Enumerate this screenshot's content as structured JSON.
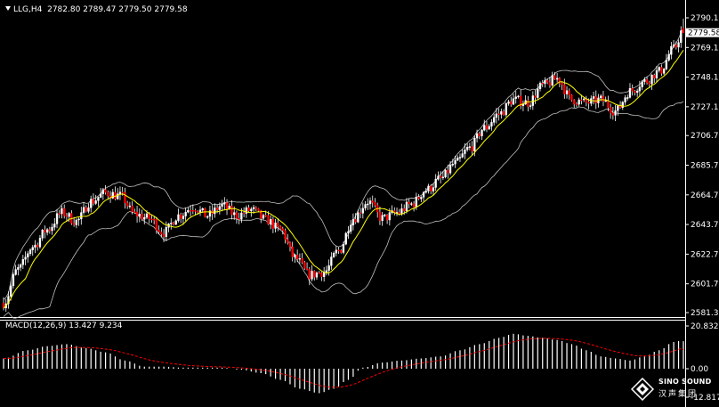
{
  "header": {
    "symbol": "LLG,H4",
    "open": "2782.80",
    "high": "2789.47",
    "low": "2779.50",
    "close": "2779.58"
  },
  "macd_header": {
    "name": "MACD(12,26,9)",
    "main": "13.427",
    "signal": "9.234"
  },
  "colors": {
    "background": "#000000",
    "bull_candle": "#ffffff",
    "bear_candle": "#ff0000",
    "wick": "#ffffff",
    "mid_band": "#ffff00",
    "bands": "#c0c0c0",
    "signal_line": "#ff0000",
    "axis": "#ffffff",
    "current_price_tag_bg": "#ffffff",
    "current_price_tag_text": "#000000"
  },
  "logo": {
    "icon": "diamond-logo-icon",
    "title": "SINO SOUND",
    "subtitle": "汉声集团"
  },
  "chart_data": [
    {
      "type": "candlestick",
      "title": "",
      "yaxis_ticks": [
        "2790.10",
        "2769.10",
        "2748.10",
        "2727.10",
        "2706.70",
        "2685.70",
        "2664.70",
        "2643.70",
        "2622.70",
        "2601.70",
        "2581.30"
      ],
      "ylim": [
        2581.3,
        2790.1
      ],
      "current_price": "2779.58",
      "grid": false,
      "keypoints": [
        [
          0,
          2588
        ],
        [
          6,
          2612
        ],
        [
          12,
          2628
        ],
        [
          18,
          2640
        ],
        [
          24,
          2652
        ],
        [
          30,
          2646
        ],
        [
          36,
          2660
        ],
        [
          42,
          2666
        ],
        [
          48,
          2664
        ],
        [
          54,
          2651
        ],
        [
          60,
          2648
        ],
        [
          66,
          2638
        ],
        [
          72,
          2650
        ],
        [
          78,
          2656
        ],
        [
          84,
          2650
        ],
        [
          90,
          2657
        ],
        [
          96,
          2650
        ],
        [
          102,
          2654
        ],
        [
          108,
          2647
        ],
        [
          114,
          2640
        ],
        [
          120,
          2620
        ],
        [
          126,
          2608
        ],
        [
          132,
          2610
        ],
        [
          138,
          2625
        ],
        [
          144,
          2648
        ],
        [
          150,
          2660
        ],
        [
          156,
          2648
        ],
        [
          162,
          2652
        ],
        [
          168,
          2658
        ],
        [
          174,
          2668
        ],
        [
          180,
          2676
        ],
        [
          186,
          2687
        ],
        [
          192,
          2698
        ],
        [
          198,
          2712
        ],
        [
          204,
          2722
        ],
        [
          210,
          2732
        ],
        [
          216,
          2730
        ],
        [
          222,
          2742
        ],
        [
          228,
          2747
        ],
        [
          234,
          2732
        ],
        [
          240,
          2730
        ],
        [
          246,
          2732
        ],
        [
          252,
          2724
        ],
        [
          258,
          2738
        ],
        [
          264,
          2745
        ],
        [
          270,
          2752
        ],
        [
          276,
          2768
        ],
        [
          280,
          2782
        ]
      ]
    },
    {
      "type": "bar",
      "title": "",
      "series": [
        {
          "name": "MACD(12,26,9)",
          "type": "histogram",
          "last": 13.427
        },
        {
          "name": "signal",
          "type": "line",
          "last": 9.234
        }
      ],
      "yaxis_ticks": [
        "20.832",
        "0.00",
        "-12.817"
      ],
      "ylim": [
        -12.817,
        20.832
      ],
      "keypoints": [
        [
          0,
          5
        ],
        [
          10,
          9
        ],
        [
          18,
          11
        ],
        [
          26,
          12
        ],
        [
          34,
          10
        ],
        [
          42,
          8
        ],
        [
          50,
          4
        ],
        [
          58,
          1
        ],
        [
          66,
          1
        ],
        [
          74,
          0.5
        ],
        [
          82,
          0.5
        ],
        [
          90,
          0.5
        ],
        [
          98,
          -0.5
        ],
        [
          106,
          -2
        ],
        [
          114,
          -5
        ],
        [
          122,
          -9
        ],
        [
          130,
          -11
        ],
        [
          136,
          -9
        ],
        [
          142,
          -5
        ],
        [
          148,
          0.5
        ],
        [
          156,
          3
        ],
        [
          164,
          4
        ],
        [
          172,
          5
        ],
        [
          180,
          6
        ],
        [
          188,
          9
        ],
        [
          196,
          12
        ],
        [
          204,
          15
        ],
        [
          210,
          17
        ],
        [
          216,
          16
        ],
        [
          222,
          15
        ],
        [
          228,
          14
        ],
        [
          234,
          12
        ],
        [
          240,
          9
        ],
        [
          246,
          6
        ],
        [
          252,
          5
        ],
        [
          258,
          4
        ],
        [
          264,
          6
        ],
        [
          270,
          9
        ],
        [
          276,
          13
        ],
        [
          280,
          14
        ]
      ]
    }
  ]
}
